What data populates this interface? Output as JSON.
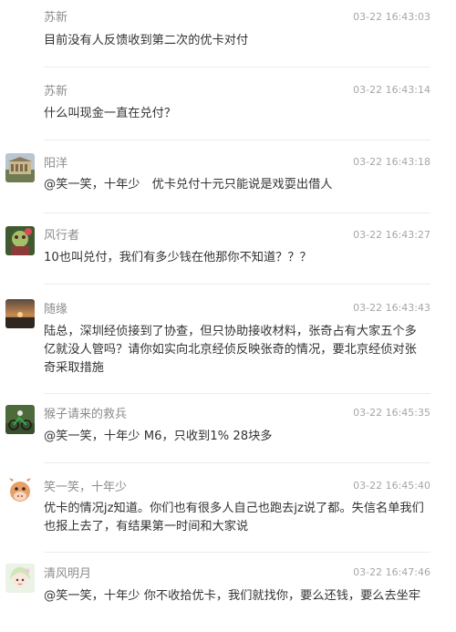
{
  "messages": [
    {
      "name": "苏新",
      "time": "03-22 16:43:03",
      "text": "目前没有人反馈收到第二次的优卡对付",
      "avatar_icon": ""
    },
    {
      "name": "苏新",
      "time": "03-22 16:43:14",
      "text": "什么叫现金一直在兑付？",
      "avatar_icon": ""
    },
    {
      "name": "阳洋",
      "time": "03-22 16:43:18",
      "text": "@笑一笑，十年少　优卡兑付十元只能说是戏耍出借人",
      "avatar_icon": "building-avatar-icon"
    },
    {
      "name": "风行者",
      "time": "03-22 16:43:27",
      "text": "10也叫兑付，我们有多少钱在他那你不知道？？？",
      "avatar_icon": "character-avatar-icon"
    },
    {
      "name": "随缘",
      "time": "03-22 16:43:43",
      "text": "陆总，深圳经侦接到了协查，但只协助接收材料，张奇占有大家五个多亿就没人管吗？请你如实向北京经侦反映张奇的情况，要北京经侦对张奇采取措施",
      "avatar_icon": "sunset-avatar-icon"
    },
    {
      "name": "猴子请来的救兵",
      "time": "03-22 16:45:35",
      "text": "@笑一笑，十年少 M6，只收到1% 28块多",
      "avatar_icon": "bicycle-avatar-icon"
    },
    {
      "name": "笑一笑，十年少",
      "time": "03-22 16:45:40",
      "text": "优卡的情况jz知道。你们也有很多人自己也跑去jz说了都。失信名单我们也报上去了，有结果第一时间和大家说",
      "avatar_icon": "cartoon-cow-avatar-icon"
    },
    {
      "name": "清风明月",
      "time": "03-22 16:47:46",
      "text": "@笑一笑，十年少 你不收拾优卡，我们就找你，要么还钱，要么去坐牢",
      "avatar_icon": "cartoon-girl-avatar-icon"
    }
  ]
}
